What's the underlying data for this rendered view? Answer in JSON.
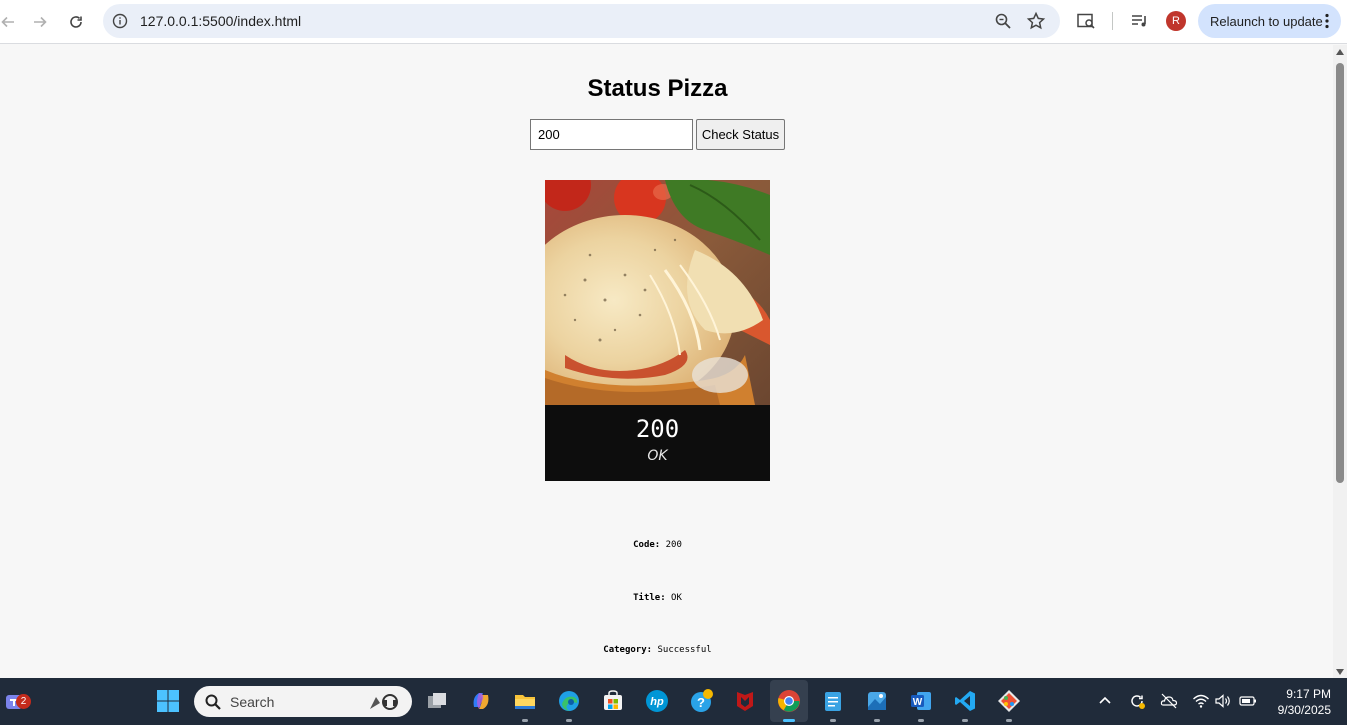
{
  "browser": {
    "url": "127.0.0.1:5500/index.html",
    "relaunch_label": "Relaunch to update",
    "avatar_letter": "R",
    "accent": "#d3e3fd"
  },
  "page": {
    "title": "Status Pizza",
    "input_value": "200",
    "button_label": "Check Status",
    "card": {
      "code": "200",
      "title": "OK"
    },
    "details": [
      {
        "label": "Code:",
        "value": "200"
      },
      {
        "label": "Title:",
        "value": "OK"
      },
      {
        "label": "Category:",
        "value": "Successful"
      }
    ]
  },
  "taskbar": {
    "search_label": "Search",
    "notification_count": "2",
    "time": "9:17 PM",
    "date": "9/30/2025",
    "apps": [
      "teams-icon",
      "windows-start-icon",
      "task-view-icon",
      "copilot-icon",
      "file-explorer-icon",
      "edge-icon",
      "microsoft-store-icon",
      "hp-icon",
      "help-icon",
      "mcafee-icon",
      "chrome-icon",
      "notepad-icon",
      "photos-icon",
      "word-icon",
      "vscode-icon",
      "git-icon"
    ]
  }
}
